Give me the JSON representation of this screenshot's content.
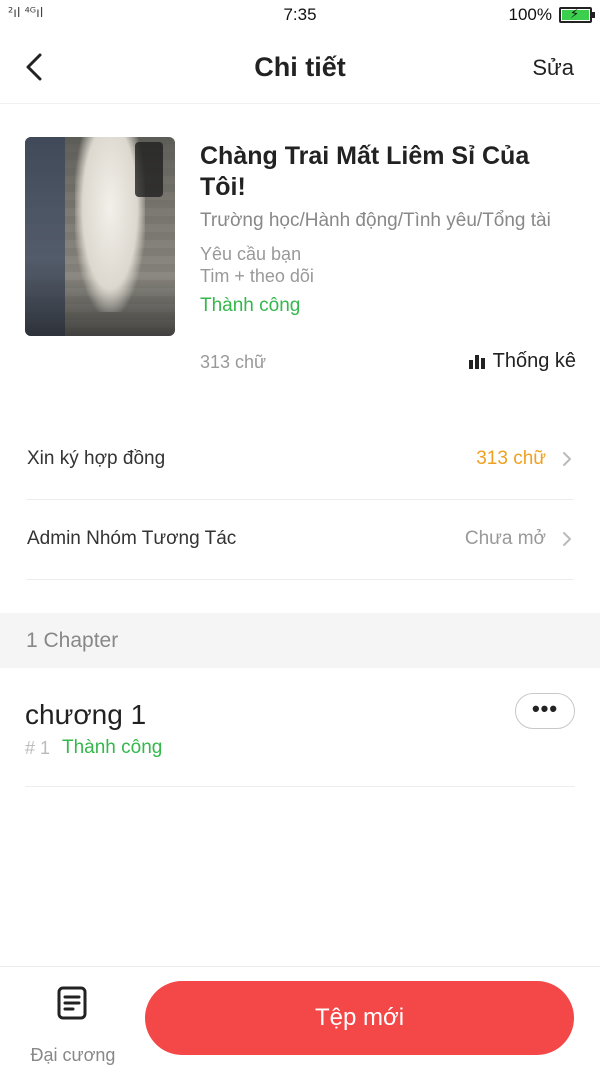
{
  "status_bar": {
    "signal": "²ıl ⁴ᴳıl",
    "time": "7:35",
    "battery_percent": "100%",
    "battery_level": 1.0,
    "battery_color": "#3ccf4e"
  },
  "nav": {
    "back_icon": "chevron-left-icon",
    "title": "Chi tiết",
    "edit_label": "Sửa"
  },
  "book": {
    "cover_icon": "book-cover-image",
    "title": "Chàng Trai Mất Liêm Sỉ Của Tôi!",
    "genres": "Trường học/Hành động/Tình yêu/Tổng tài",
    "requirement_line1": "Yêu cầu bạn",
    "requirement_line2": "Tim + theo dõi",
    "status": "Thành công",
    "status_color": "#34b84b",
    "word_count": "313 chữ",
    "stats_label": "Thống kê",
    "stats_icon": "bar-chart-icon"
  },
  "rows": [
    {
      "label": "Xin ký hợp đồng",
      "value": "313 chữ",
      "value_color": "#f0a020"
    },
    {
      "label": "Admin Nhóm Tương Tác",
      "value": "Chưa mở",
      "value_color": "#999999"
    }
  ],
  "chapters_section": {
    "title": "1 Chapter"
  },
  "chapters": [
    {
      "title": "chương 1",
      "number": "# 1",
      "status": "Thành công"
    }
  ],
  "bottom_bar": {
    "outline_label": "Đại cương",
    "outline_icon": "document-list-icon",
    "new_file_label": "Tệp mới",
    "new_file_color": "#f44747"
  }
}
